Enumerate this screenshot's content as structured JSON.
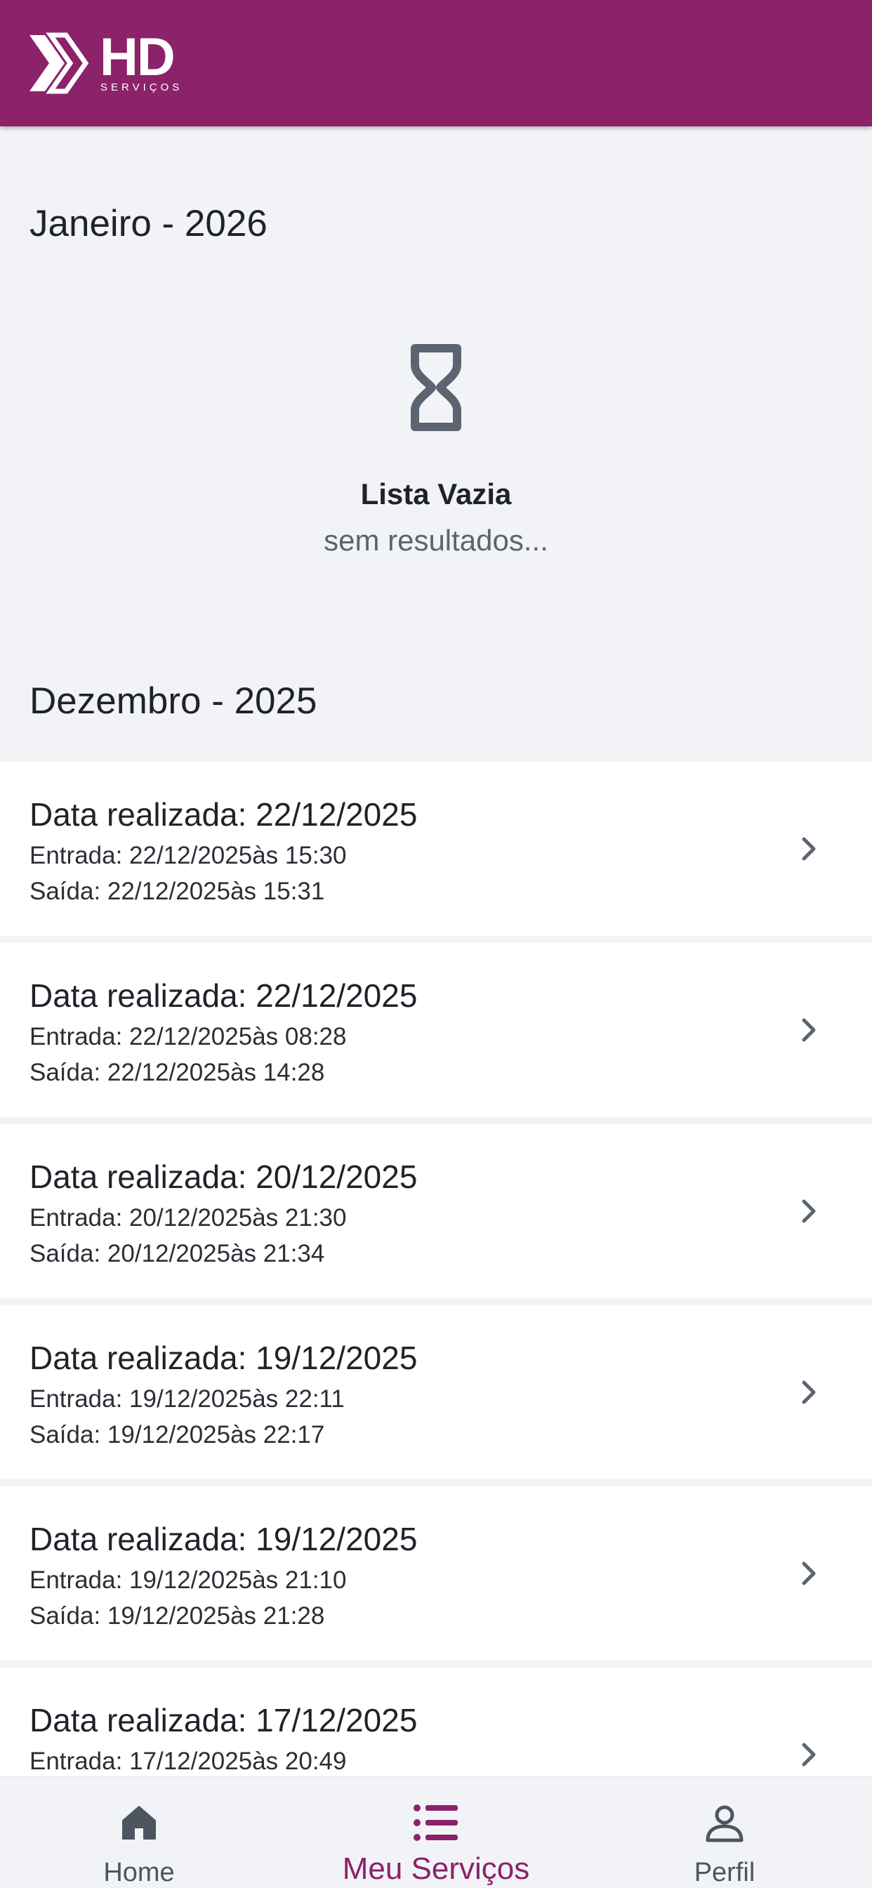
{
  "header": {
    "logo_text": "HD",
    "logo_sub": "SERVIÇOS"
  },
  "sections": [
    {
      "title": "Janeiro - 2026"
    },
    {
      "title": "Dezembro - 2025"
    }
  ],
  "empty_state": {
    "icon": "hourglass-icon",
    "title": "Lista Vazia",
    "subtitle": "sem resultados..."
  },
  "services": [
    {
      "date": "Data realizada: 22/12/2025",
      "entrada": "Entrada: 22/12/2025às 15:30",
      "saida": "Saída: 22/12/2025às 15:31"
    },
    {
      "date": "Data realizada: 22/12/2025",
      "entrada": "Entrada: 22/12/2025às 08:28",
      "saida": "Saída: 22/12/2025às 14:28"
    },
    {
      "date": "Data realizada: 20/12/2025",
      "entrada": "Entrada: 20/12/2025às 21:30",
      "saida": "Saída: 20/12/2025às 21:34"
    },
    {
      "date": "Data realizada: 19/12/2025",
      "entrada": "Entrada: 19/12/2025às 22:11",
      "saida": "Saída: 19/12/2025às 22:17"
    },
    {
      "date": "Data realizada: 19/12/2025",
      "entrada": "Entrada: 19/12/2025às 21:10",
      "saida": "Saída: 19/12/2025às 21:28"
    },
    {
      "date": "Data realizada: 17/12/2025",
      "entrada": "Entrada: 17/12/2025às 20:49",
      "saida": ""
    }
  ],
  "nav": {
    "items": [
      {
        "label": "Home",
        "icon": "home-icon"
      },
      {
        "label": "Meu Serviços",
        "icon": "list-icon",
        "active": true
      },
      {
        "label": "Perfil",
        "icon": "person-icon"
      }
    ]
  },
  "colors": {
    "brand": "#8b226a",
    "background": "#f2f3f7",
    "icon": "#5b6470"
  }
}
